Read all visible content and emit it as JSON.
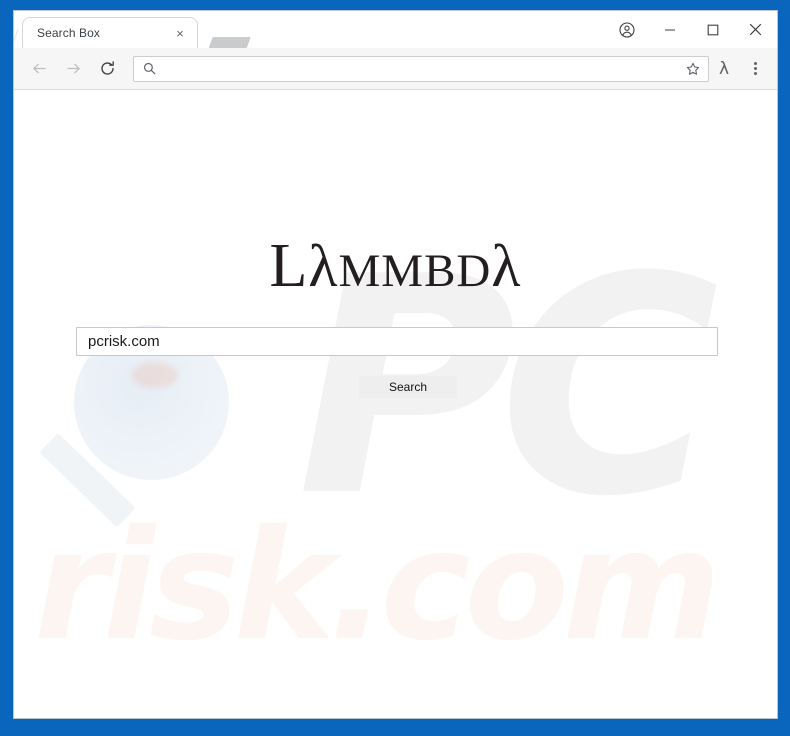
{
  "window": {
    "frame_color": "#0a66bd",
    "controls": [
      {
        "name": "profile",
        "icon": "profile-icon",
        "label": ""
      },
      {
        "name": "minimize",
        "icon": "minimize-icon",
        "label": ""
      },
      {
        "name": "maximize",
        "icon": "maximize-icon",
        "label": ""
      },
      {
        "name": "close",
        "icon": "close-icon",
        "label": ""
      }
    ]
  },
  "tabs": {
    "active": {
      "title": "Search Box",
      "close_label": "×"
    }
  },
  "toolbar": {
    "back": {
      "icon": "back-arrow-icon",
      "enabled": false
    },
    "forward": {
      "icon": "forward-arrow-icon",
      "enabled": false
    },
    "reload": {
      "icon": "reload-icon",
      "enabled": true
    },
    "omnibox": {
      "value": "",
      "placeholder": "",
      "icon": "search-icon"
    },
    "bookmark": {
      "icon": "star-icon"
    },
    "extension": {
      "icon": "lambda-icon",
      "glyph": "λ"
    },
    "menu": {
      "icon": "three-dot-menu-icon"
    }
  },
  "page": {
    "logo": {
      "full_text": "LλMMBDλ",
      "parts": [
        {
          "text": "L",
          "style": "cap"
        },
        {
          "text": "λ",
          "style": "lam"
        },
        {
          "text": "MMBD",
          "style": "sm"
        },
        {
          "text": "λ",
          "style": "lam"
        }
      ]
    },
    "search_input": {
      "value": "pcrisk.com",
      "placeholder": ""
    },
    "search_button": {
      "label": "Search"
    },
    "watermarks": {
      "brand_top": "PC",
      "brand_bottom": "risk.com",
      "glass": "magnifier-watermark"
    }
  }
}
